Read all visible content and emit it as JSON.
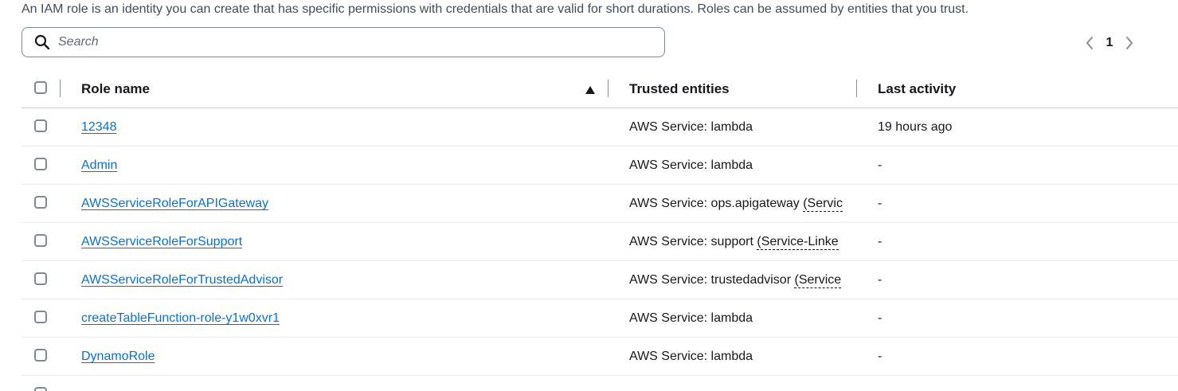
{
  "description": "An IAM role is an identity you can create that has specific permissions with credentials that are valid for short durations. Roles can be assumed by entities that you trust.",
  "search": {
    "placeholder": "Search",
    "value": ""
  },
  "pagination": {
    "current_page": "1"
  },
  "columns": {
    "role_name": "Role name",
    "trusted_entities": "Trusted entities",
    "last_activity": "Last activity"
  },
  "rows": [
    {
      "role_name": "12348",
      "trusted_prefix": "AWS Service: lambda",
      "trusted_link": "",
      "last_activity": "19 hours ago"
    },
    {
      "role_name": "Admin",
      "trusted_prefix": "AWS Service: lambda",
      "trusted_link": "",
      "last_activity": "-"
    },
    {
      "role_name": "AWSServiceRoleForAPIGateway",
      "trusted_prefix": "AWS Service: ops.apigateway",
      "trusted_link": "(Servic",
      "last_activity": "-"
    },
    {
      "role_name": "AWSServiceRoleForSupport",
      "trusted_prefix": "AWS Service: support",
      "trusted_link": "(Service-Linke",
      "last_activity": "-"
    },
    {
      "role_name": "AWSServiceRoleForTrustedAdvisor",
      "trusted_prefix": "AWS Service: trustedadvisor",
      "trusted_link": "(Service",
      "last_activity": "-"
    },
    {
      "role_name": "createTableFunction-role-y1w0xvr1",
      "trusted_prefix": "AWS Service: lambda",
      "trusted_link": "",
      "last_activity": "-"
    },
    {
      "role_name": "DynamoRole",
      "trusted_prefix": "AWS Service: lambda",
      "trusted_link": "",
      "last_activity": "-"
    }
  ],
  "icons": {
    "search": "search-icon",
    "prev": "chevron-left-icon",
    "next": "chevron-right-icon",
    "sort": "sort-ascending-icon"
  },
  "colors": {
    "link": "#0972d3",
    "border": "#7d8998",
    "text": "#16191f"
  }
}
